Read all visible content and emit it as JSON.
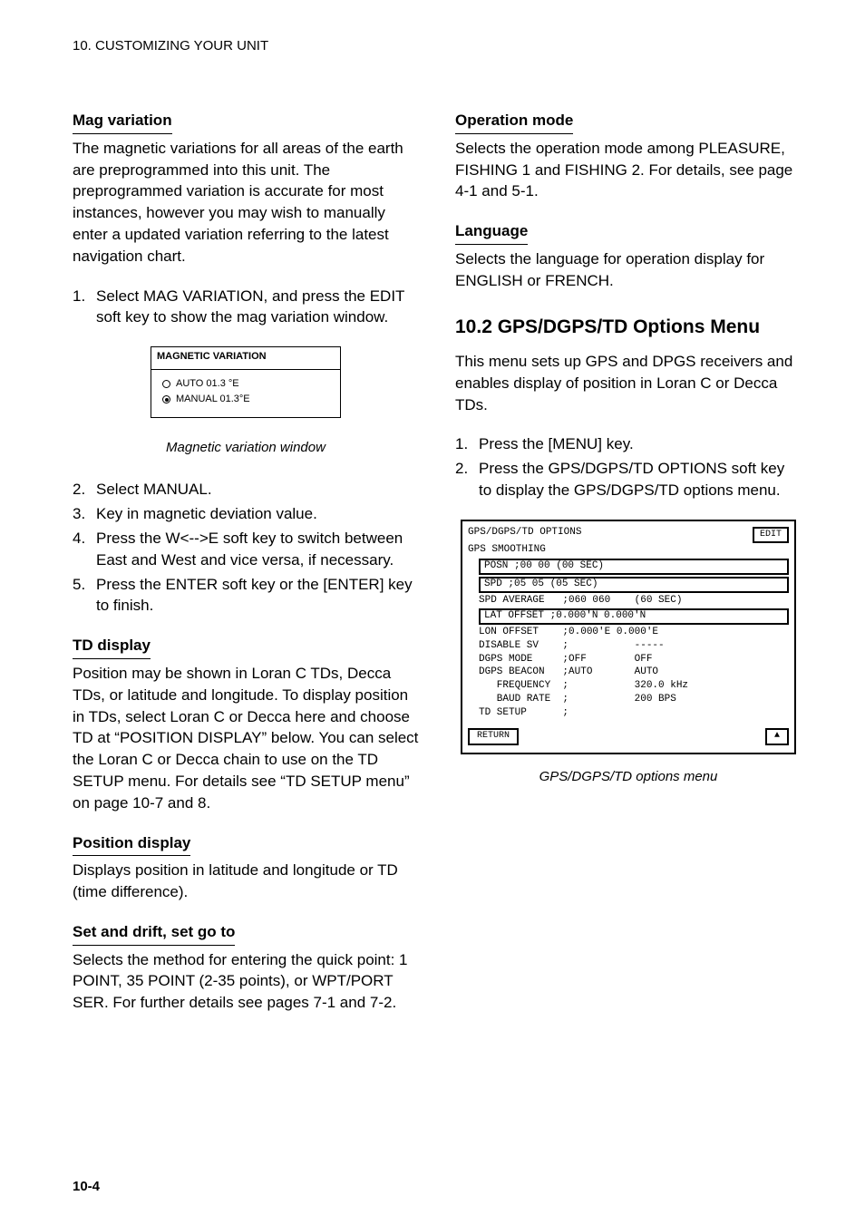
{
  "header": "10. CUSTOMIZING YOUR UNIT",
  "left": {
    "mag_heading": "Mag variation",
    "mag_para": "The magnetic variations for all areas of the earth are preprogrammed into this unit. The preprogrammed variation is accurate for most instances, however you may wish to manually enter a updated variation referring to the latest navigation chart.",
    "mag_list1_num": "1.",
    "mag_list1_txt": "Select MAG VARIATION, and press the EDIT soft key to show the mag variation window.",
    "window_title": "MAGNETIC VARIATION",
    "window_auto": "AUTO 01.3 °E",
    "window_manual": "MANUAL 01.3°E",
    "window_caption": "Magnetic variation window",
    "list2_num": "2.",
    "list2_txt": "Select MANUAL.",
    "list3_num": "3.",
    "list3_txt": "Key in magnetic deviation value.",
    "list4_num": "4.",
    "list4_txt": "Press the W<-->E soft key to switch between East and West and vice versa, if necessary.",
    "list5_num": "5.",
    "list5_txt": "Press the ENTER soft key or the [ENTER] key to finish.",
    "td_heading": "TD display",
    "td_para": "Position may be shown in Loran C TDs, Decca TDs, or latitude and longitude. To display position in TDs, select Loran C or Decca here and choose TD at “POSITION DISPLAY” below. You can select the Loran C or Decca chain to use on the TD SETUP menu. For details see “TD SETUP menu” on page 10-7 and 8.",
    "pos_heading": "Position display",
    "pos_para": "Displays position in latitude and longitude or TD (time difference).",
    "quick_heading": "Set and drift, set go to",
    "quick_para": "Selects the method for entering the quick point: 1 POINT, 35 POINT (2-35 points), or WPT/PORT SER. For further details see pages 7-1 and 7-2."
  },
  "right": {
    "op_heading": "Operation mode",
    "op_para": "Selects the operation mode among PLEASURE, FISHING 1 and FISHING 2. For details, see page 4-1 and 5-1.",
    "lang_heading": "Language",
    "lang_para": "Selects the language for operation display for ENGLISH or FRENCH.",
    "big_heading": "10.2 GPS/DGPS/TD Options Menu",
    "gps_intro": "This menu sets up GPS and DPGS receivers and enables display of position in Loran C or Decca TDs.",
    "gps_l1_num": "1.",
    "gps_l1_txt": "Press the [MENU] key.",
    "gps_l2_num": "2.",
    "gps_l2_txt": "Press the GPS/DGPS/TD OPTIONS soft key to display the GPS/DGPS/TD options menu.",
    "menu_title": "GPS/DGPS/TD OPTIONS",
    "menu_edit": "EDIT",
    "menu_line1_left": "GPS SMOOTHING",
    "menu_hl1": "POSN  ;00 00    (00 SEC)",
    "menu_hl2": "SPD   ;05 05    (05 SEC)",
    "menu_line2": "SPD AVERAGE   ;060 060    (60 SEC)",
    "menu_hl3": "LAT OFFSET    ;0.000'N 0.000'N",
    "menu_line3": "LON OFFSET    ;0.000'E 0.000'E",
    "menu_line4": "DISABLE SV    ;           -----",
    "menu_line5": "DGPS MODE     ;OFF        OFF",
    "menu_line6": "DGPS BEACON   ;AUTO       AUTO",
    "menu_line7": "   FREQUENCY  ;           320.0 kHz",
    "menu_line8": "   BAUD RATE  ;           200 BPS",
    "menu_line9": "TD SETUP      ;",
    "menu_btn_left": "RETURN",
    "menu_btn_right": "▲",
    "menu_caption": "GPS/DGPS/TD options menu"
  },
  "footer": "10-4"
}
